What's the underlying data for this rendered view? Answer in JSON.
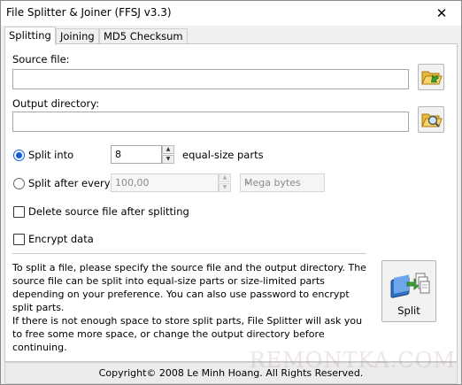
{
  "window": {
    "title": "File Splitter & Joiner (FFSJ v3.3)",
    "close_glyph": "✕"
  },
  "tabs": [
    {
      "label": "Splitting",
      "active": true
    },
    {
      "label": "Joining",
      "active": false
    },
    {
      "label": "MD5 Checksum",
      "active": false
    }
  ],
  "splitting": {
    "source_label": "Source file:",
    "source_value": "",
    "browse_source_icon": "folder-open-icon",
    "output_label": "Output directory:",
    "output_value": "",
    "browse_output_icon": "folder-search-icon",
    "split_into_label": "Split into",
    "split_into_value": "8",
    "split_into_checked": true,
    "equal_size_label": "equal-size parts",
    "split_after_label": "Split after every",
    "split_after_value": "100,00",
    "split_after_checked": false,
    "unit_selected": "Mega bytes",
    "delete_source_label": "Delete source file after splitting",
    "delete_source_checked": false,
    "encrypt_label": "Encrypt data",
    "encrypt_checked": false,
    "info_paragraph_1": "To split a file, please specify the source file and the output directory. The source file can be split into equal-size parts or size-limited parts depending on your preference. You can also use password to encrypt split parts.",
    "info_paragraph_2": "If there is not enough space to store split parts, File Splitter will ask you to free some more space, or change the output directory before continuing.",
    "split_button_label": "Split",
    "split_button_icon": "book-split-icon"
  },
  "footer": {
    "copyright": "Copyright© 2008 Le Minh Hoang. All Rights Reserved."
  },
  "watermark": "REMONTKA.COM",
  "colors": {
    "accent": "#0c5fd6",
    "panel_bg": "#ffffff",
    "window_bg": "#f0f0f0"
  }
}
